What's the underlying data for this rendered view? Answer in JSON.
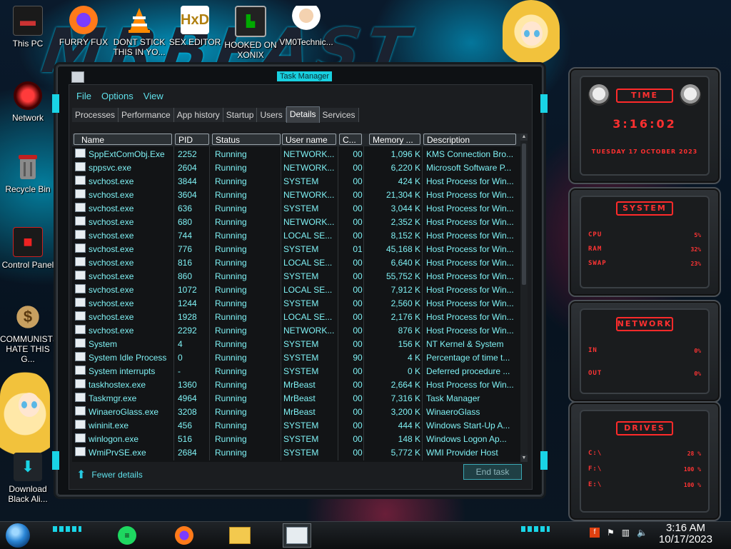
{
  "desktop": {
    "icons": [
      {
        "label": "This PC",
        "icon": "this-pc-icon"
      },
      {
        "label": "FURRY FUX",
        "icon": "firefox-icon"
      },
      {
        "label": "DONT STICK THIS IN YO...",
        "icon": "vlc-cone-icon"
      },
      {
        "label": "SEX EDITOR",
        "icon": "hxd-editor-icon"
      },
      {
        "label": "HOOKED ON XONIX",
        "icon": "xonix-game-icon"
      },
      {
        "label": "VM0Technic...",
        "icon": "doctor-avatar-icon"
      },
      {
        "label": "Network",
        "icon": "network-icon"
      },
      {
        "label": "Recycle Bin",
        "icon": "recycle-bin-icon"
      },
      {
        "label": "Control Panel",
        "icon": "control-panel-icon"
      },
      {
        "label": "COMMUNISTS HATE THIS G...",
        "icon": "money-bag-icon"
      },
      {
        "label": "Download Black Ali...",
        "icon": "download-icon"
      }
    ]
  },
  "taskmanager": {
    "title": "Task Manager",
    "menu": [
      "File",
      "Options",
      "View"
    ],
    "tabs": [
      "Processes",
      "Performance",
      "App history",
      "Startup",
      "Users",
      "Details",
      "Services"
    ],
    "active_tab": "Details",
    "columns": [
      "Name",
      "PID",
      "Status",
      "User name",
      "C...",
      "Memory ...",
      "Description"
    ],
    "rows": [
      {
        "name": "SppExtComObj.Exe",
        "pid": "2252",
        "status": "Running",
        "user": "NETWORK...",
        "cpu": "00",
        "mem": "1,096 K",
        "desc": "KMS Connection Bro..."
      },
      {
        "name": "sppsvc.exe",
        "pid": "2604",
        "status": "Running",
        "user": "NETWORK...",
        "cpu": "00",
        "mem": "6,220 K",
        "desc": "Microsoft Software P..."
      },
      {
        "name": "svchost.exe",
        "pid": "3844",
        "status": "Running",
        "user": "SYSTEM",
        "cpu": "00",
        "mem": "424 K",
        "desc": "Host Process for Win..."
      },
      {
        "name": "svchost.exe",
        "pid": "3604",
        "status": "Running",
        "user": "NETWORK...",
        "cpu": "00",
        "mem": "21,304 K",
        "desc": "Host Process for Win..."
      },
      {
        "name": "svchost.exe",
        "pid": "636",
        "status": "Running",
        "user": "SYSTEM",
        "cpu": "00",
        "mem": "3,044 K",
        "desc": "Host Process for Win..."
      },
      {
        "name": "svchost.exe",
        "pid": "680",
        "status": "Running",
        "user": "NETWORK...",
        "cpu": "00",
        "mem": "2,352 K",
        "desc": "Host Process for Win..."
      },
      {
        "name": "svchost.exe",
        "pid": "744",
        "status": "Running",
        "user": "LOCAL SE...",
        "cpu": "00",
        "mem": "8,152 K",
        "desc": "Host Process for Win..."
      },
      {
        "name": "svchost.exe",
        "pid": "776",
        "status": "Running",
        "user": "SYSTEM",
        "cpu": "01",
        "mem": "45,168 K",
        "desc": "Host Process for Win..."
      },
      {
        "name": "svchost.exe",
        "pid": "816",
        "status": "Running",
        "user": "LOCAL SE...",
        "cpu": "00",
        "mem": "6,640 K",
        "desc": "Host Process for Win..."
      },
      {
        "name": "svchost.exe",
        "pid": "860",
        "status": "Running",
        "user": "SYSTEM",
        "cpu": "00",
        "mem": "55,752 K",
        "desc": "Host Process for Win..."
      },
      {
        "name": "svchost.exe",
        "pid": "1072",
        "status": "Running",
        "user": "LOCAL SE...",
        "cpu": "00",
        "mem": "7,912 K",
        "desc": "Host Process for Win..."
      },
      {
        "name": "svchost.exe",
        "pid": "1244",
        "status": "Running",
        "user": "SYSTEM",
        "cpu": "00",
        "mem": "2,560 K",
        "desc": "Host Process for Win..."
      },
      {
        "name": "svchost.exe",
        "pid": "1928",
        "status": "Running",
        "user": "LOCAL SE...",
        "cpu": "00",
        "mem": "2,176 K",
        "desc": "Host Process for Win..."
      },
      {
        "name": "svchost.exe",
        "pid": "2292",
        "status": "Running",
        "user": "NETWORK...",
        "cpu": "00",
        "mem": "876 K",
        "desc": "Host Process for Win..."
      },
      {
        "name": "System",
        "pid": "4",
        "status": "Running",
        "user": "SYSTEM",
        "cpu": "00",
        "mem": "156 K",
        "desc": "NT Kernel & System"
      },
      {
        "name": "System Idle Process",
        "pid": "0",
        "status": "Running",
        "user": "SYSTEM",
        "cpu": "90",
        "mem": "4 K",
        "desc": "Percentage of time t..."
      },
      {
        "name": "System interrupts",
        "pid": "-",
        "status": "Running",
        "user": "SYSTEM",
        "cpu": "00",
        "mem": "0 K",
        "desc": "Deferred procedure ..."
      },
      {
        "name": "taskhostex.exe",
        "pid": "1360",
        "status": "Running",
        "user": "MrBeast",
        "cpu": "00",
        "mem": "2,664 K",
        "desc": "Host Process for Win..."
      },
      {
        "name": "Taskmgr.exe",
        "pid": "4964",
        "status": "Running",
        "user": "MrBeast",
        "cpu": "00",
        "mem": "7,316 K",
        "desc": "Task Manager"
      },
      {
        "name": "WinaeroGlass.exe",
        "pid": "3208",
        "status": "Running",
        "user": "MrBeast",
        "cpu": "00",
        "mem": "3,200 K",
        "desc": "WinaeroGlass"
      },
      {
        "name": "wininit.exe",
        "pid": "456",
        "status": "Running",
        "user": "SYSTEM",
        "cpu": "00",
        "mem": "444 K",
        "desc": "Windows Start-Up A..."
      },
      {
        "name": "winlogon.exe",
        "pid": "516",
        "status": "Running",
        "user": "SYSTEM",
        "cpu": "00",
        "mem": "148 K",
        "desc": "Windows Logon Ap..."
      },
      {
        "name": "WmiPrvSE.exe",
        "pid": "2684",
        "status": "Running",
        "user": "SYSTEM",
        "cpu": "00",
        "mem": "5,772 K",
        "desc": "WMI Provider Host"
      }
    ],
    "fewer_details": "Fewer details",
    "end_task": "End task"
  },
  "gadgets": {
    "time": {
      "title": "TIME",
      "clock": "3:16:02",
      "date": "TUESDAY 17 OCTOBER 2023"
    },
    "system": {
      "title": "SYSTEM",
      "labels": [
        "CPU",
        "RAM",
        "SWAP"
      ],
      "values": [
        "5%",
        "32%",
        "23%"
      ]
    },
    "network": {
      "title": "NETWORK",
      "labels": [
        "IN",
        "OUT"
      ],
      "values": [
        "0%",
        "0%"
      ]
    },
    "drives": {
      "title": "DRIVES",
      "labels": [
        "C:\\",
        "F:\\",
        "E:\\"
      ],
      "values": [
        "28 %",
        "100 %",
        "100 %"
      ]
    }
  },
  "taskbar": {
    "apps": [
      "spotify-icon",
      "firefox-icon",
      "file-explorer-icon",
      "task-manager-icon"
    ],
    "clock_time": "3:16 AM",
    "clock_date": "10/17/2023",
    "accent": "#19d4e6"
  }
}
